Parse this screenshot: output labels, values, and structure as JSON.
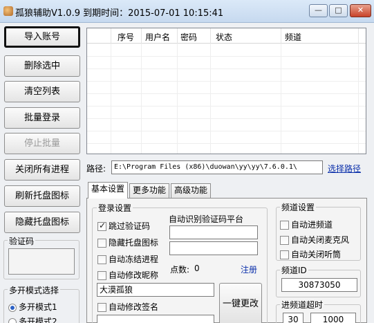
{
  "window": {
    "title": "孤狼辅助V1.0.9  到期时间：2015-07-01 10:15:41",
    "minimize": "—",
    "maximize": "□",
    "close": "✕"
  },
  "left_buttons": [
    {
      "label": "导入账号"
    },
    {
      "label": "删除选中"
    },
    {
      "label": "清空列表"
    },
    {
      "label": "批量登录"
    },
    {
      "label": "停止批量"
    },
    {
      "label": "关闭所有进程"
    },
    {
      "label": "刷新托盘图标"
    },
    {
      "label": "隐藏托盘图标"
    }
  ],
  "captcha": {
    "label": "验证码"
  },
  "multi_mode": {
    "label": "多开模式选择",
    "options": [
      "多开模式1",
      "多开模式2"
    ],
    "selected": 0
  },
  "table": {
    "columns": [
      "序号",
      "用户名",
      "密码",
      "状态",
      "频道"
    ]
  },
  "path": {
    "label": "路径:",
    "value": "E:\\Program Files (x86)\\duowan\\yy\\yy\\7.6.0.1\\",
    "browse": "选择路径"
  },
  "tabs": [
    "基本设置",
    "更多功能",
    "高级功能"
  ],
  "login_settings": {
    "group_label": "登录设置",
    "skip_captcha": "跳过验证码",
    "skip_captcha_checked": true,
    "hide_tray_icon": "隐藏托盘图标",
    "auto_freeze": "自动冻结进程",
    "auto_nickname": "自动修改昵称",
    "nickname_value": "大漠孤狼",
    "auto_signature": "自动修改签名",
    "signature_value": "...",
    "captcha_platform_label": "自动识别验证码平台",
    "points_label": "点数:",
    "points_value": "0",
    "register_link": "注册",
    "apply_button": "一键更改"
  },
  "channel_settings": {
    "group_label": "频道设置",
    "auto_enter": "自动进频道",
    "auto_close_mic": "自动关闭麦克风",
    "auto_close_listen": "自动关闭听筒"
  },
  "channel_id": {
    "label": "频道ID",
    "value": "30873050"
  },
  "enter_timeout": {
    "label": "进频道超时",
    "value1": "30",
    "value2": "1000"
  }
}
